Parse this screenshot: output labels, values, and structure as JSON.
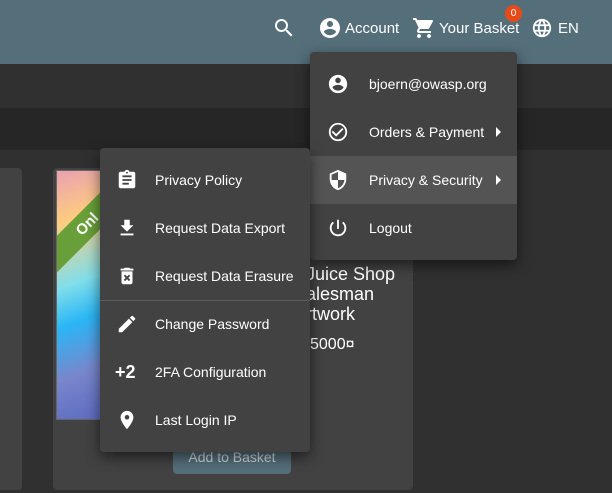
{
  "toolbar": {
    "search_icon": "search-icon",
    "account_label": "Account",
    "basket_label": "Your Basket",
    "basket_count": "0",
    "language_label": "EN"
  },
  "account_menu": {
    "items": [
      {
        "label": "bjoern@owasp.org",
        "icon": "account-circle-icon"
      },
      {
        "label": "Orders & Payment",
        "icon": "check-circle-icon"
      },
      {
        "label": "Privacy & Security",
        "icon": "shield-icon"
      },
      {
        "label": "Logout",
        "icon": "power-icon"
      }
    ]
  },
  "privacy_menu": {
    "items": [
      {
        "label": "Privacy Policy",
        "icon": "clipboard-icon"
      },
      {
        "label": "Request Data Export",
        "icon": "download-icon"
      },
      {
        "label": "Request Data Erasure",
        "icon": "delete-icon"
      },
      {
        "label": "Change Password",
        "icon": "edit-icon"
      },
      {
        "label": "2FA Configuration",
        "icon": "two-factor-icon",
        "glyph": "+2"
      },
      {
        "label": "Last Login IP",
        "icon": "location-icon"
      }
    ]
  },
  "product": {
    "ribbon": "Onl",
    "name_line1": "Juice Shop",
    "name_line2": "alesman",
    "name_line3": "rtwork",
    "price": "5000¤",
    "add_button": "Add to Basket"
  },
  "colors": {
    "toolbar": "#546e7a",
    "background": "#303030",
    "menu": "#424242",
    "badge": "#e64a19",
    "ribbon": "#689f38"
  }
}
